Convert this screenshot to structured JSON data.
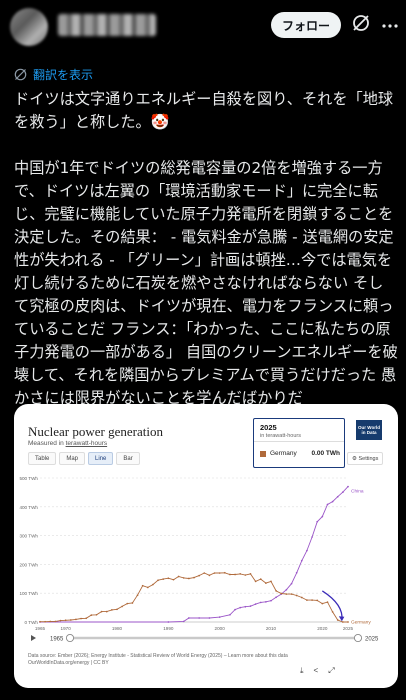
{
  "header": {
    "follow_label": "フォロー"
  },
  "post": {
    "translate_label": "翻訳を表示",
    "text": "ドイツは文字通りエネルギー自殺を図り、それを「地球を救う」と称した。🤡\n\n中国が1年でドイツの総発電容量の2倍を増強する一方で、ドイツは左翼の「環境活動家モード」に完全に転じ、完璧に機能していた原子力発電所を閉鎖することを決定した。その結果： - 電気料金が急騰 - 送電網の安定性が失われる - 「グリーン」計画は頓挫…今では電気を灯し続けるために石炭を燃やさなければならない そして究極の皮肉は、ドイツが現在、電力をフランスに頼っていることだ フランス：「わかった、ここに私たちの原子力発電の一部がある」 自国のクリーンエネルギーを破壊して、それを隣国からプレミアムで買うだけだった 愚かさには限界がないことを学んだばかりだ"
  },
  "card": {
    "title": "Nuclear power generation",
    "subtitle_prefix": "Measured in ",
    "subtitle_unit": "terawatt-hours",
    "tabs": [
      "Table",
      "Map",
      "Line",
      "Bar"
    ],
    "active_tab": "Line",
    "settings_label": "Settings",
    "owid_label": "Our World in Data",
    "tooltip": {
      "year": "2025",
      "unit": "in terawatt-hours",
      "series": "Germany",
      "value": "0.00 TWh"
    },
    "timeline_start": "1965",
    "timeline_end": "2025",
    "footer_line1": "Data source: Ember (2026); Energy Institute - Statistical Review of World Energy (2025) – Learn more about this data",
    "footer_line2": "OurWorldInData.org/energy | CC BY"
  },
  "colors": {
    "china": "#9b56c8",
    "germany": "#b06a3b",
    "arrow": "#3a2bb8",
    "link": "#1d9bf0"
  },
  "chart_data": {
    "type": "line",
    "xlabel": "",
    "ylabel": "",
    "ylim": [
      0,
      500
    ],
    "xlim": [
      1965,
      2025
    ],
    "yticks": [
      "0 TWh",
      "100 TWh",
      "200 TWh",
      "300 TWh",
      "400 TWh",
      "500 TWh"
    ],
    "ytick_values": [
      0,
      100,
      200,
      300,
      400,
      500
    ],
    "xticks": [
      "1965",
      "1970",
      "1980",
      "1990",
      "2000",
      "2010",
      "2020",
      "2025"
    ],
    "xtick_values": [
      1965,
      1970,
      1980,
      1990,
      2000,
      2010,
      2020,
      2025
    ],
    "series": [
      {
        "name": "China",
        "x": [
          1965,
          1990,
          1993,
          1994,
          1996,
          1998,
          2000,
          2002,
          2003,
          2004,
          2005,
          2006,
          2007,
          2008,
          2009,
          2010,
          2011,
          2012,
          2013,
          2014,
          2015,
          2016,
          2017,
          2018,
          2019,
          2020,
          2021,
          2022,
          2023,
          2024,
          2025
        ],
        "values": [
          0,
          0,
          2,
          14,
          14,
          14,
          17,
          25,
          43,
          50,
          53,
          55,
          62,
          68,
          70,
          74,
          86,
          97,
          112,
          133,
          171,
          213,
          248,
          295,
          348,
          366,
          408,
          418,
          435,
          451,
          470
        ]
      },
      {
        "name": "Germany",
        "x": [
          1965,
          1966,
          1967,
          1968,
          1969,
          1970,
          1971,
          1972,
          1973,
          1974,
          1975,
          1976,
          1977,
          1978,
          1979,
          1980,
          1981,
          1982,
          1983,
          1984,
          1985,
          1986,
          1987,
          1988,
          1989,
          1990,
          1991,
          1992,
          1993,
          1994,
          1995,
          1996,
          1997,
          1998,
          1999,
          2000,
          2001,
          2002,
          2003,
          2004,
          2005,
          2006,
          2007,
          2008,
          2009,
          2010,
          2011,
          2012,
          2013,
          2014,
          2015,
          2016,
          2017,
          2018,
          2019,
          2020,
          2021,
          2022,
          2023,
          2024,
          2025
        ],
        "values": [
          1,
          1,
          2,
          2,
          5,
          6,
          7,
          9,
          12,
          13,
          24,
          25,
          36,
          36,
          42,
          44,
          54,
          64,
          66,
          93,
          126,
          120,
          130,
          145,
          149,
          152,
          147,
          158,
          153,
          151,
          154,
          161,
          170,
          162,
          170,
          170,
          171,
          165,
          165,
          167,
          163,
          167,
          141,
          149,
          135,
          141,
          108,
          99,
          97,
          97,
          92,
          85,
          76,
          76,
          75,
          64,
          69,
          35,
          7,
          0,
          0
        ]
      }
    ]
  }
}
